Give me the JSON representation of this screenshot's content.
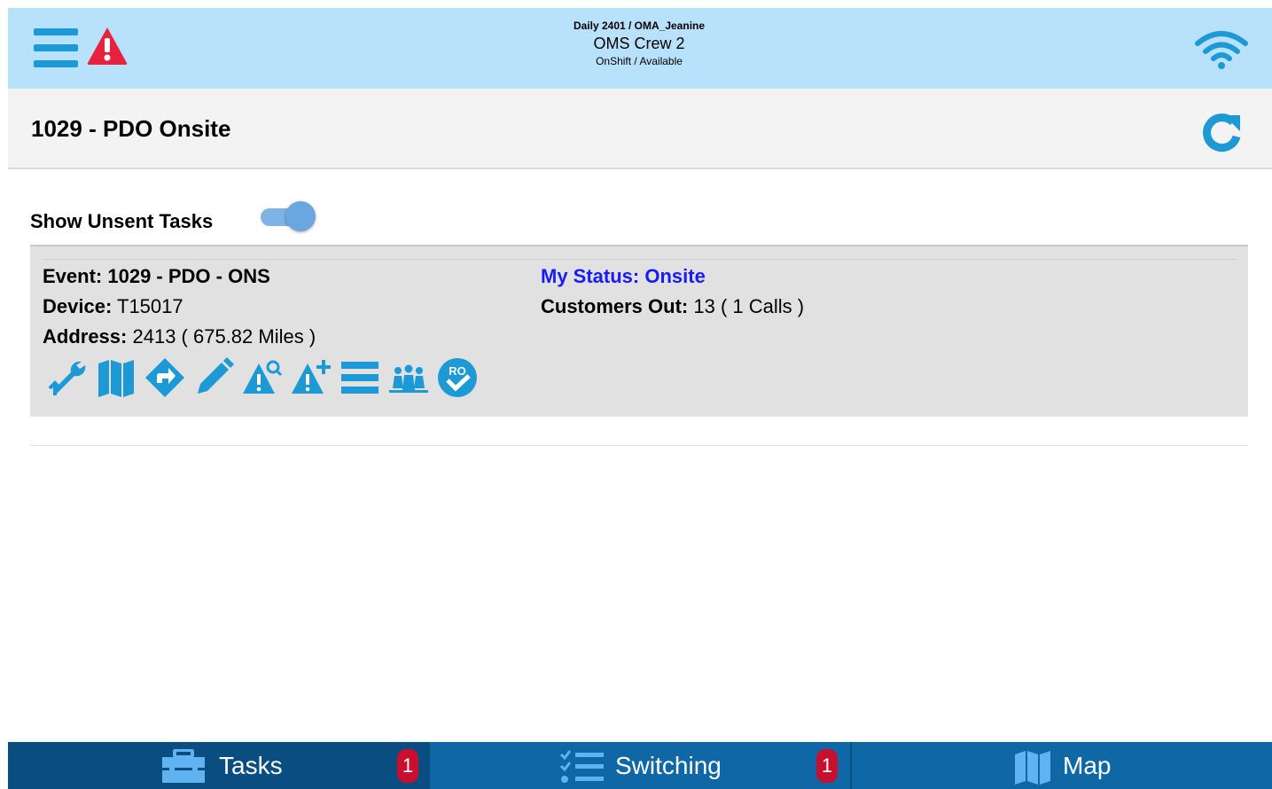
{
  "header": {
    "crew_context": "Daily 2401 / OMA_Jeanine",
    "crew_name": "OMS Crew 2",
    "crew_status": "OnShift / Available",
    "accent_color": "#1d9ad6",
    "background_color": "#b8e1fb",
    "icons": [
      "menu-icon",
      "alert-icon",
      "wifi-icon"
    ]
  },
  "titlebar": {
    "title": "1029 - PDO Onsite",
    "refresh_icon": "refresh-icon"
  },
  "filters": {
    "show_unsent_label": "Show Unsent Tasks",
    "show_unsent_on": true
  },
  "event_card": {
    "event_label": "Event:",
    "event_value": "1029 - PDO - ONS",
    "device_label": "Device:",
    "device_value": "T15017",
    "address_label": "Address:",
    "address_value": "2413 ( 675.82 Miles )",
    "status_label": "My Status:",
    "status_value": "Onsite",
    "customers_label": "Customers Out:",
    "customers_value": "13 ( 1 Calls )",
    "status_color": "#1a1aff",
    "actions": [
      "wrench-arrow-icon",
      "map-icon",
      "directions-icon",
      "edit-pencil-icon",
      "alert-search-icon",
      "alert-add-icon",
      "list-icon",
      "crew-group-icon",
      "ro-check-icon"
    ]
  },
  "bottom_nav": {
    "tabs": [
      {
        "label": "Tasks",
        "icon": "toolbox-icon",
        "badge": "1"
      },
      {
        "label": "Switching",
        "icon": "checklist-icon",
        "badge": "1"
      },
      {
        "label": "Map",
        "icon": "map-icon"
      }
    ],
    "background_color": "#0f67a6",
    "badge_color": "#c8102e"
  }
}
